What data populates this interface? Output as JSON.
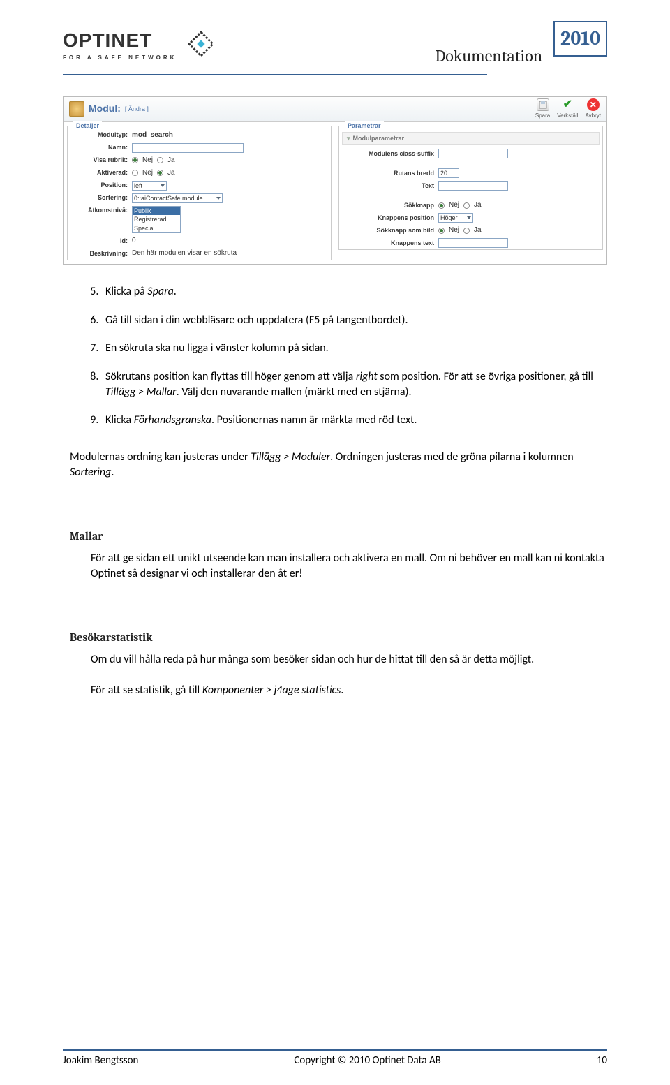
{
  "header": {
    "logo_word": "OPTINET",
    "logo_tag": "FOR A SAFE NETWORK",
    "doc_title": "Dokumentation",
    "year": "2010"
  },
  "screenshot": {
    "modul_label": "Modul:",
    "modul_sub": "[ Ändra ]",
    "btn_save": "Spara",
    "btn_apply": "Verkställ",
    "btn_cancel": "Avbryt",
    "left": {
      "legend": "Detaljer",
      "modultyp_label": "Modultyp:",
      "modultyp_value": "mod_search",
      "namn_label": "Namn:",
      "visarubrik_label": "Visa rubrik:",
      "aktiverad_label": "Aktiverad:",
      "nej": "Nej",
      "ja": "Ja",
      "position_label": "Position:",
      "position_value": "left",
      "sortering_label": "Sortering:",
      "sortering_value": "0::aiContactSafe module",
      "atkomst_label": "Åtkomstnivå:",
      "access_options": [
        "Publik",
        "Registrerad",
        "Special"
      ],
      "id_label": "Id:",
      "id_value": "0",
      "beskrivning_label": "Beskrivning:",
      "beskrivning_value": "Den här modulen visar en sökruta"
    },
    "right": {
      "legend": "Parametrar",
      "modulparam": "Modulparametrar",
      "class_suffix": "Modulens class-suffix",
      "rutans_bredd": "Rutans bredd",
      "rutans_bredd_val": "20",
      "text_label": "Text",
      "sokknapp": "Sökknapp",
      "knapp_pos": "Knappens position",
      "knapp_pos_val": "Höger",
      "sokknapp_bild": "Sökknapp som bild",
      "knapp_text": "Knappens text",
      "nej": "Nej",
      "ja": "Ja"
    }
  },
  "list": {
    "start": "5",
    "item5_a": "Klicka på ",
    "item5_b": "Spara",
    "item5_c": ".",
    "item6": "Gå till sidan i din webbläsare och uppdatera (F5 på tangentbordet).",
    "item7": "En sökruta ska nu ligga i vänster kolumn på sidan.",
    "item8_a": "Sökrutans position kan flyttas till höger genom att välja ",
    "item8_b": "right",
    "item8_c": " som position. För att se övriga positioner, gå till ",
    "item8_d": "Tillägg > Mallar",
    "item8_e": ". Välj den nuvarande mallen (märkt med en stjärna).",
    "item9_a": "Klicka ",
    "item9_b": "Förhandsgranska",
    "item9_c": ". Positionernas namn är märkta med röd text."
  },
  "para1_a": "Modulernas ordning kan justeras under ",
  "para1_b": "Tillägg > Moduler",
  "para1_c": ". Ordningen justeras med de gröna pilarna i kolumnen ",
  "para1_d": "Sortering",
  "para1_e": ".",
  "h_mallar": "Mallar",
  "para_mallar": "För att ge sidan ett unikt utseende kan man installera och aktivera en mall. Om ni behöver en mall kan ni kontakta Optinet så designar vi och installerar den åt er!",
  "h_besok": "Besökarstatistik",
  "para_besok1": "Om du vill hålla reda på hur många som besöker sidan och hur de hittat till den så är detta möjligt.",
  "para_besok2_a": "För att se statistik, gå till ",
  "para_besok2_b": "Komponenter > j4age statistics",
  "para_besok2_c": ".",
  "footer": {
    "author": "Joakim Bengtsson",
    "copyright": "Copyright © 2010 Optinet Data AB",
    "page": "10"
  }
}
